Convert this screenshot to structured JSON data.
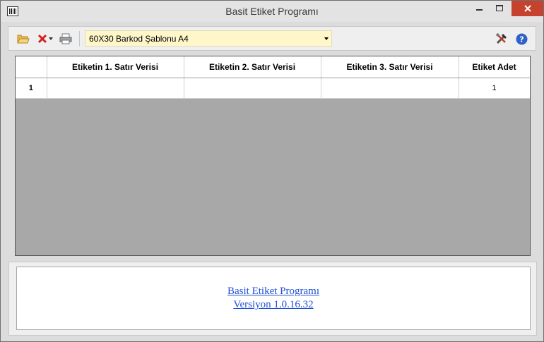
{
  "window": {
    "title": "Basit Etiket Programı"
  },
  "toolbar": {
    "template_selected": "60X30 Barkod Şablonu A4",
    "icons": [
      "folder-open-icon",
      "delete-icon",
      "print-icon",
      "tools-icon",
      "help-icon"
    ]
  },
  "grid": {
    "columns": [
      "Etiketin 1. Satır Verisi",
      "Etiketin 2. Satır Verisi",
      "Etiketin 3. Satır Verisi",
      "Etiket Adet"
    ],
    "rows": [
      {
        "row_number": "1",
        "line1": "",
        "line2": "",
        "line3": "",
        "count": "1"
      }
    ]
  },
  "footer": {
    "app_link": "Basit Etiket Programı",
    "version_link": "Versiyon 1.0.16.32"
  },
  "colors": {
    "combo_background": "#fff6c9",
    "close_button": "#c7412f",
    "grid_empty_area": "#a8a8a8",
    "link": "#1f4fd6"
  }
}
